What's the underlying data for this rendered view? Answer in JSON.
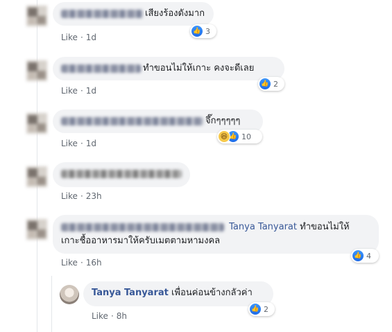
{
  "comments": [
    {
      "text": "เสียงร้องดังมาก",
      "like": "Like",
      "time": "1d",
      "reaction_count": "3"
    },
    {
      "text": "ทำขอนไม่ให้เกาะ คงจะดีเลย",
      "like": "Like",
      "time": "1d",
      "reaction_count": "2"
    },
    {
      "text": "จึ๊กๆๆๆๆๆ",
      "like": "Like",
      "time": "1d",
      "reaction_count": "10"
    },
    {
      "text": "",
      "like": "Like",
      "time": "23h",
      "reaction_count": ""
    },
    {
      "tag": "Tanya Tanyarat",
      "text_line1": "ทำขอนไม่ให้",
      "text_line2": "เกาะชื้ออาหารมาให้ครับเมตตามหามงคล",
      "like": "Like",
      "time": "16h",
      "reaction_count": "4"
    }
  ],
  "reply": {
    "name": "Tanya Tanyarat",
    "text": "เพื่อนค่อนข้างกลัวค่า",
    "like": "Like",
    "time": "8h",
    "reaction_count": "2"
  },
  "colors": {
    "link": "#385898",
    "bubble": "#f2f3f5",
    "like_blue": "#1f6ce8",
    "meta": "#606770"
  },
  "icons": {
    "like": "thumbs-up-icon",
    "haha": "haha-face-icon"
  }
}
